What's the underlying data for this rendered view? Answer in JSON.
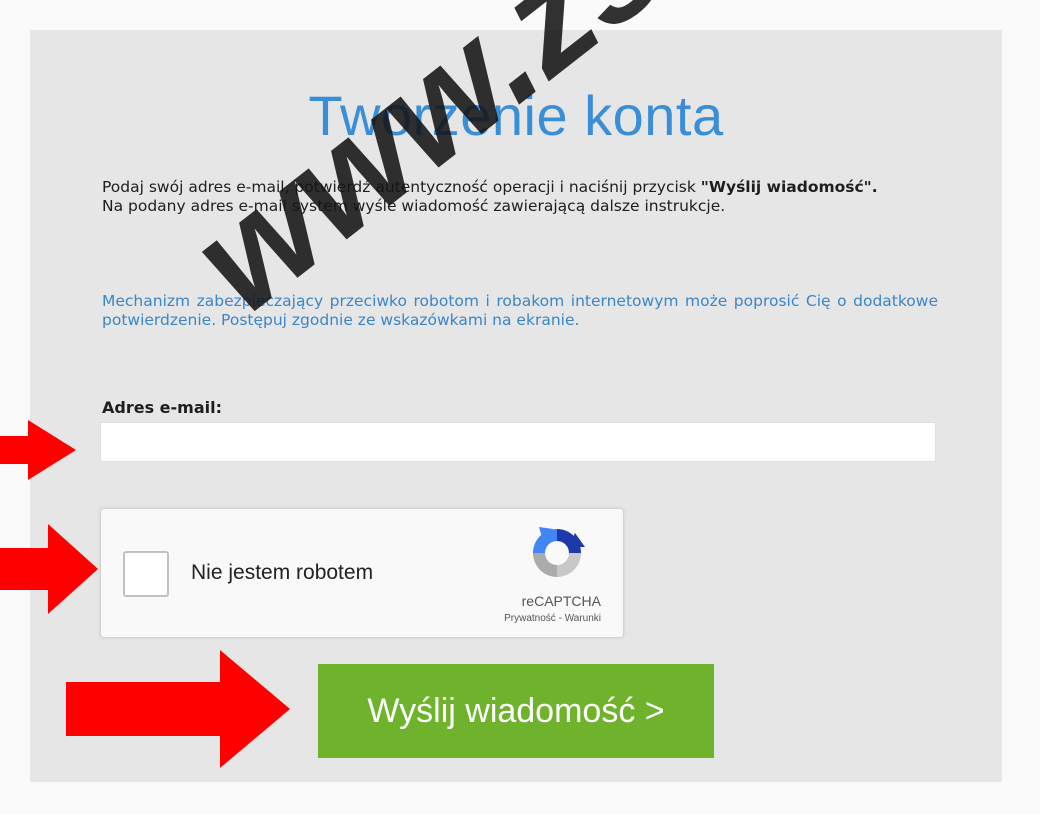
{
  "title": "Tworzenie konta",
  "instructions": {
    "line1": "Podaj swój adres e-mail, potwierdź autentyczność operacji i naciśnij przycisk",
    "button_ref": "\"Wyślij wiadomość\".",
    "line2": "Na podany adres e-mail system wyśle wiadomość zawierającą dalsze instrukcje."
  },
  "notice": "Mechanizm zabezpieczający przeciwko robotom i robakom internetowym może poprosić Cię o dodatkowe potwierdzenie. Postępuj zgodnie ze wskazówkami na ekranie.",
  "email": {
    "label": "Adres e-mail:",
    "value": "",
    "placeholder": ""
  },
  "captcha": {
    "label": "Nie jestem robotem",
    "brand": "reCAPTCHA",
    "privacy": "Prywatność",
    "separator": " - ",
    "terms": "Warunki"
  },
  "submit_label": "Wyślij wiadomość >",
  "watermark": "www.zs",
  "colors": {
    "title": "#3a8ed8",
    "notice": "#3a86c8",
    "button": "#6fb32c",
    "arrow": "#ff0000",
    "panel": "#e6e6e6"
  },
  "icons": {
    "captcha_logo": "recaptcha-logo-icon",
    "arrows": "red-arrow-icon"
  }
}
